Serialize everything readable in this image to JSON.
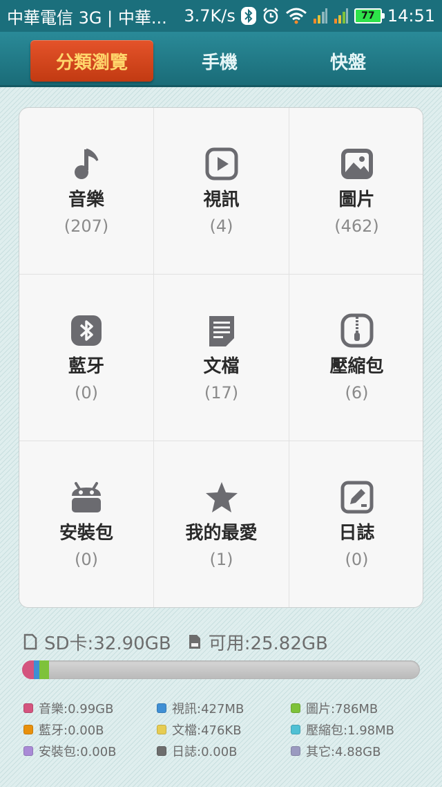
{
  "status_bar": {
    "carrier": "中華電信 3G | 中華...",
    "speed": "3.7K/s",
    "battery": "77",
    "time": "14:51"
  },
  "tabs": [
    {
      "label": "分類瀏覽",
      "active": true
    },
    {
      "label": "手機",
      "active": false
    },
    {
      "label": "快盤",
      "active": false
    }
  ],
  "categories": [
    {
      "label": "音樂",
      "count": "(207)",
      "icon": "music-note-icon"
    },
    {
      "label": "視訊",
      "count": "(4)",
      "icon": "video-play-icon"
    },
    {
      "label": "圖片",
      "count": "(462)",
      "icon": "image-icon"
    },
    {
      "label": "藍牙",
      "count": "(0)",
      "icon": "bluetooth-icon"
    },
    {
      "label": "文檔",
      "count": "(17)",
      "icon": "document-icon"
    },
    {
      "label": "壓縮包",
      "count": "(6)",
      "icon": "archive-icon"
    },
    {
      "label": "安裝包",
      "count": "(0)",
      "icon": "android-icon"
    },
    {
      "label": "我的最愛",
      "count": "(1)",
      "icon": "star-icon"
    },
    {
      "label": "日誌",
      "count": "(0)",
      "icon": "log-edit-icon"
    }
  ],
  "storage": {
    "total": "SD卡:32.90GB",
    "available": "可用:25.82GB"
  },
  "usage_bar": [
    {
      "color": "#d4547e",
      "fraction": 0.03
    },
    {
      "color": "#3f8fd4",
      "fraction": 0.013
    },
    {
      "color": "#7ec23a",
      "fraction": 0.024
    }
  ],
  "legend": [
    {
      "label": "音樂:0.99GB",
      "color": "#d4547e"
    },
    {
      "label": "視訊:427MB",
      "color": "#3f8fd4"
    },
    {
      "label": "圖片:786MB",
      "color": "#7ec23a"
    },
    {
      "label": "藍牙:0.00B",
      "color": "#e8900c"
    },
    {
      "label": "文檔:476KB",
      "color": "#e6cc52"
    },
    {
      "label": "壓縮包:1.98MB",
      "color": "#4fc0d4"
    },
    {
      "label": "安裝包:0.00B",
      "color": "#a98ad6"
    },
    {
      "label": "日誌:0.00B",
      "color": "#6d6d6d"
    },
    {
      "label": "其它:4.88GB",
      "color": "#9a9ac0"
    }
  ]
}
